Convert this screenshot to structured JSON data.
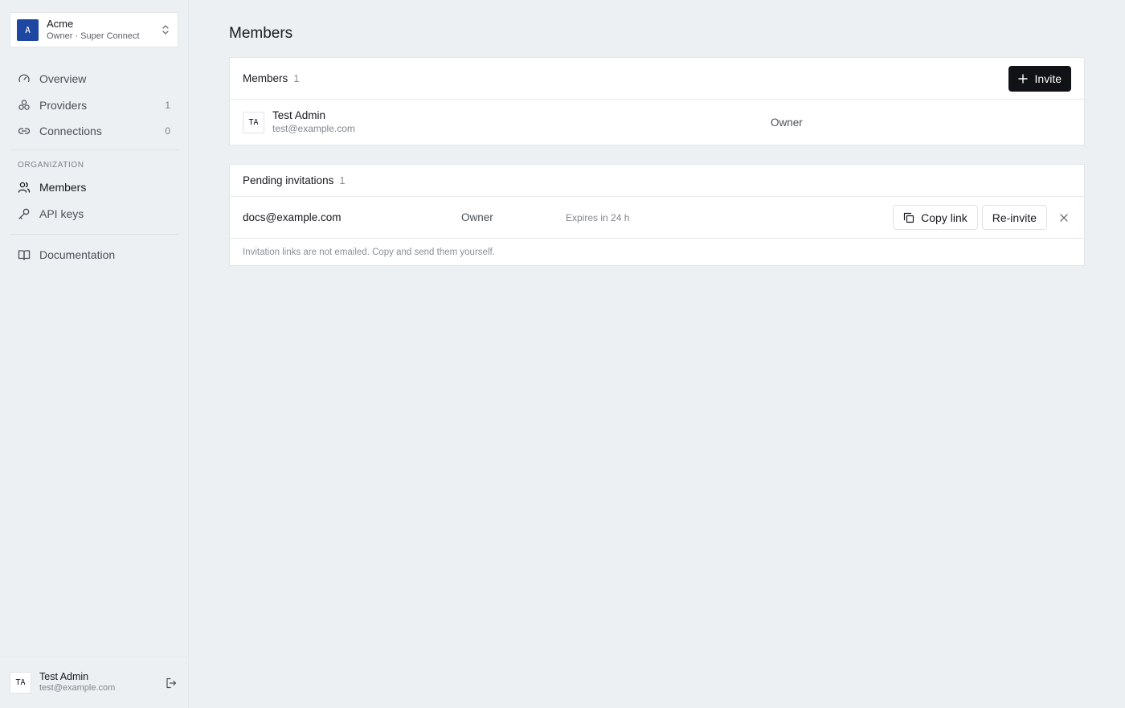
{
  "org": {
    "avatar": "A",
    "name": "Acme",
    "subtitle": "Owner · Super Connect"
  },
  "nav": {
    "primary": [
      {
        "label": "Overview",
        "icon": "gauge-icon",
        "count": ""
      },
      {
        "label": "Providers",
        "icon": "providers-icon",
        "count": "1"
      },
      {
        "label": "Connections",
        "icon": "link-icon",
        "count": "0"
      }
    ],
    "section_label": "ORGANIZATION",
    "organization": [
      {
        "label": "Members",
        "icon": "users-icon",
        "active": true
      },
      {
        "label": "API keys",
        "icon": "key-icon"
      }
    ],
    "docs": {
      "label": "Documentation",
      "icon": "book-icon"
    }
  },
  "user": {
    "initials": "TA",
    "name": "Test Admin",
    "email": "test@example.com"
  },
  "page": {
    "title": "Members"
  },
  "members_card": {
    "title": "Members",
    "count": "1",
    "invite_label": "Invite",
    "rows": [
      {
        "initials": "TA",
        "name": "Test Admin",
        "email": "test@example.com",
        "role": "Owner"
      }
    ]
  },
  "invitations_card": {
    "title": "Pending invitations",
    "count": "1",
    "rows": [
      {
        "email": "docs@example.com",
        "role": "Owner",
        "expires": "Expires in 24 h",
        "copy_label": "Copy link",
        "reinvite_label": "Re-invite"
      }
    ],
    "note": "Invitation links are not emailed. Copy and send them yourself."
  },
  "colors": {
    "accent": "#1d47a0",
    "primary_button": "#101216",
    "background": "#edf0f3"
  }
}
